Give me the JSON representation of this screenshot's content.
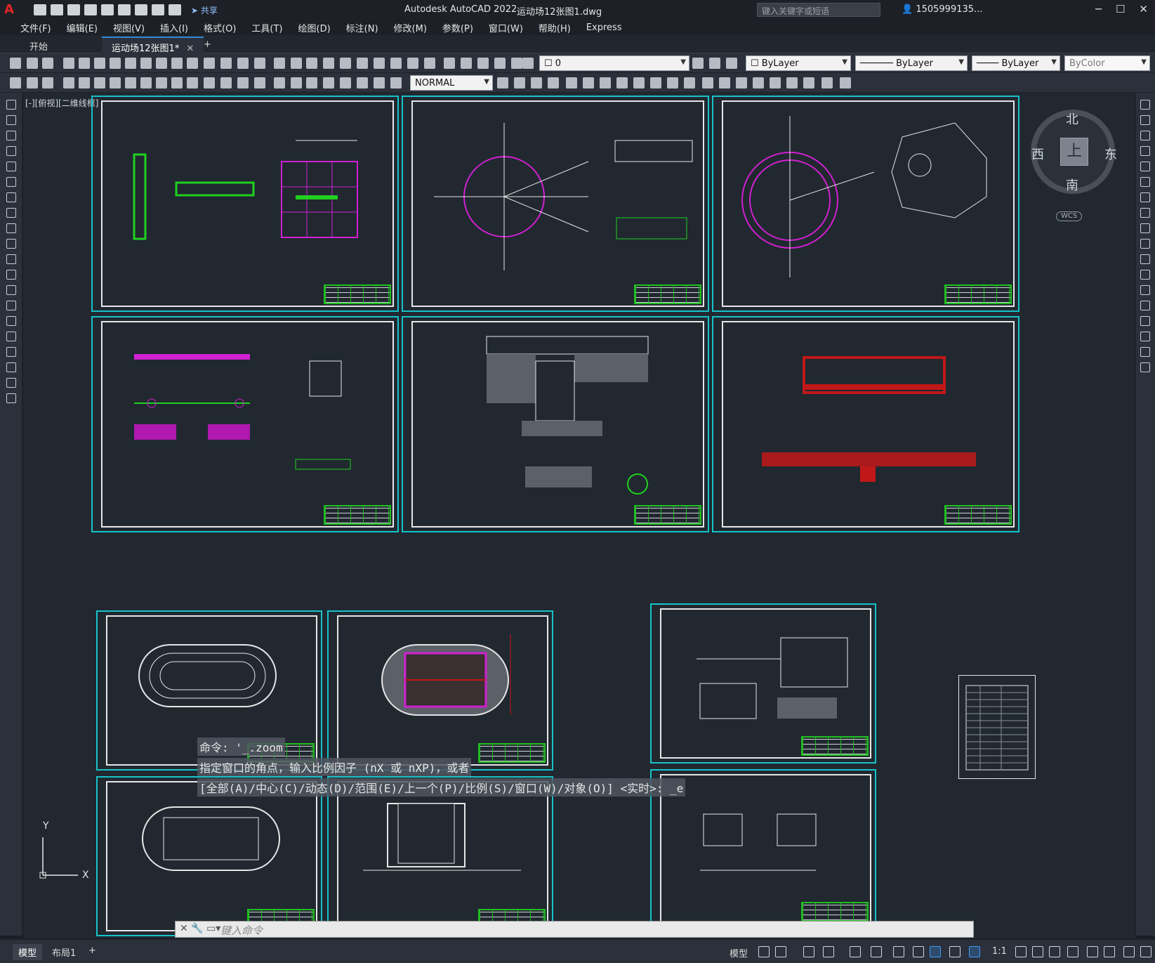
{
  "app": {
    "title": "Autodesk AutoCAD 2022",
    "filename": "运动场12张图1.dwg",
    "share_label": "共享",
    "search_placeholder": "键入关键字或短语",
    "user": "1505999135..."
  },
  "menu": {
    "items": [
      "文件(F)",
      "编辑(E)",
      "视图(V)",
      "插入(I)",
      "格式(O)",
      "工具(T)",
      "绘图(D)",
      "标注(N)",
      "修改(M)",
      "参数(P)",
      "窗口(W)",
      "帮助(H)",
      "Express"
    ]
  },
  "tabs": {
    "start": "开始",
    "doc": "运动场12张图1*",
    "add": "+"
  },
  "toolbar": {
    "layer": "0",
    "color": "ByLayer",
    "linetype": "ByLayer",
    "lineweight": "ByLayer",
    "plotstyle": "ByColor",
    "dimstyle": "NORMAL"
  },
  "viewport": {
    "label": "[-][俯视][二维线框]"
  },
  "viewcube": {
    "north": "北",
    "south": "南",
    "east": "东",
    "west": "西",
    "face": "上",
    "wcs": "WCS"
  },
  "ucs": {
    "x": "X",
    "y": "Y"
  },
  "command": {
    "history": [
      "命令: '_.zoom",
      "指定窗口的角点，输入比例因子 (nX 或 nXP)，或者",
      "[全部(A)/中心(C)/动态(D)/范围(E)/上一个(P)/比例(S)/窗口(W)/对象(O)] <实时>: _e"
    ],
    "placeholder": "键入命令"
  },
  "status": {
    "model_tab": "模型",
    "layout_tab": "布局1",
    "add": "+",
    "model_btn": "模型",
    "scale": "1:1"
  },
  "colors": {
    "sheet_border": "#16c3c9",
    "title_block": "#20d020",
    "accent": "#2f8bd6"
  }
}
